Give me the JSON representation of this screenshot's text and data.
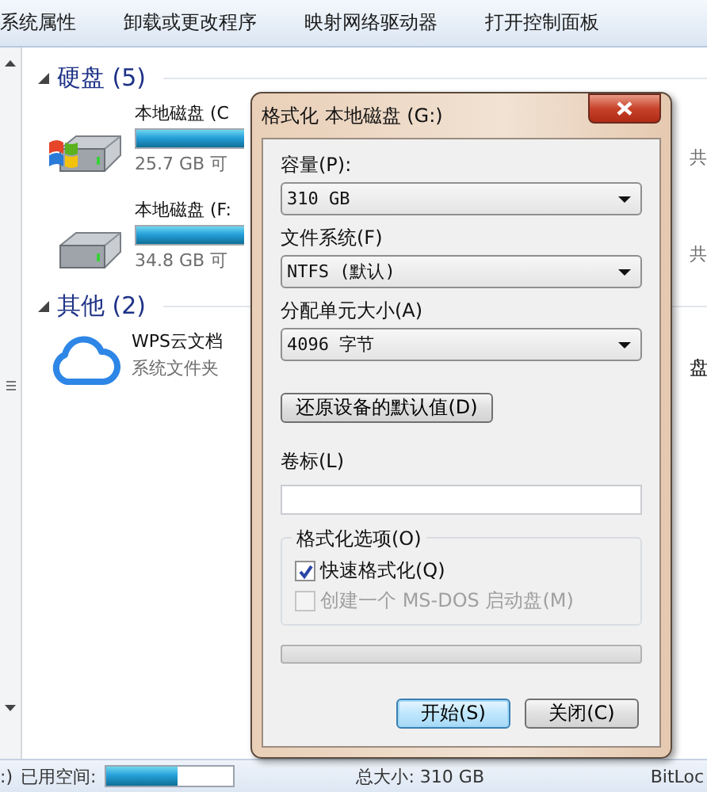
{
  "toolbar": [
    {
      "label": "系统属性"
    },
    {
      "label": "卸载或更改程序"
    },
    {
      "label": "映射网络驱动器"
    },
    {
      "label": "打开控制面板"
    }
  ],
  "groups": [
    {
      "title": "硬盘 (5)",
      "expanded": true,
      "items": [
        {
          "kind": "drive",
          "name": "本地磁盘 (C",
          "level": 1,
          "free": "25.7 GB 可",
          "total": "共"
        },
        {
          "kind": "drive",
          "name": "本地磁盘 (F:",
          "level": 1,
          "free": "34.8 GB 可",
          "total": "共"
        }
      ]
    },
    {
      "title": "其他 (2)",
      "expanded": true,
      "items": [
        {
          "kind": "folder",
          "name": "WPS云文档",
          "subtitle": "系统文件夹",
          "side": "盘"
        }
      ]
    }
  ],
  "status_bar": {
    "drive": ":)",
    "used_label": "已用空间:",
    "level": 0.57,
    "total": "总大小: 310 GB",
    "extra": "BitLoc"
  },
  "dialog": {
    "title": "格式化 本地磁盘 (G:)",
    "fields": [
      {
        "kind": "select",
        "label": "容量(P):",
        "value": "310 GB"
      },
      {
        "kind": "select",
        "label": "文件系统(F)",
        "value": "NTFS (默认)"
      },
      {
        "kind": "select",
        "label": "分配单元大小(A)",
        "value": "4096 字节"
      },
      {
        "kind": "button",
        "label": "还原设备的默认值(D)"
      },
      {
        "kind": "text",
        "label": "卷标(L)"
      }
    ],
    "options": {
      "title": "格式化选项(O)",
      "items": [
        {
          "label": "快速格式化(Q)",
          "checked": true,
          "disabled": false
        },
        {
          "label": "创建一个 MS-DOS 启动盘(M)",
          "checked": false,
          "disabled": true
        }
      ]
    },
    "progress": {
      "level": 0
    },
    "buttons": [
      {
        "label": "开始(S)",
        "default": true
      },
      {
        "label": "关闭(C)",
        "default": false
      }
    ]
  }
}
